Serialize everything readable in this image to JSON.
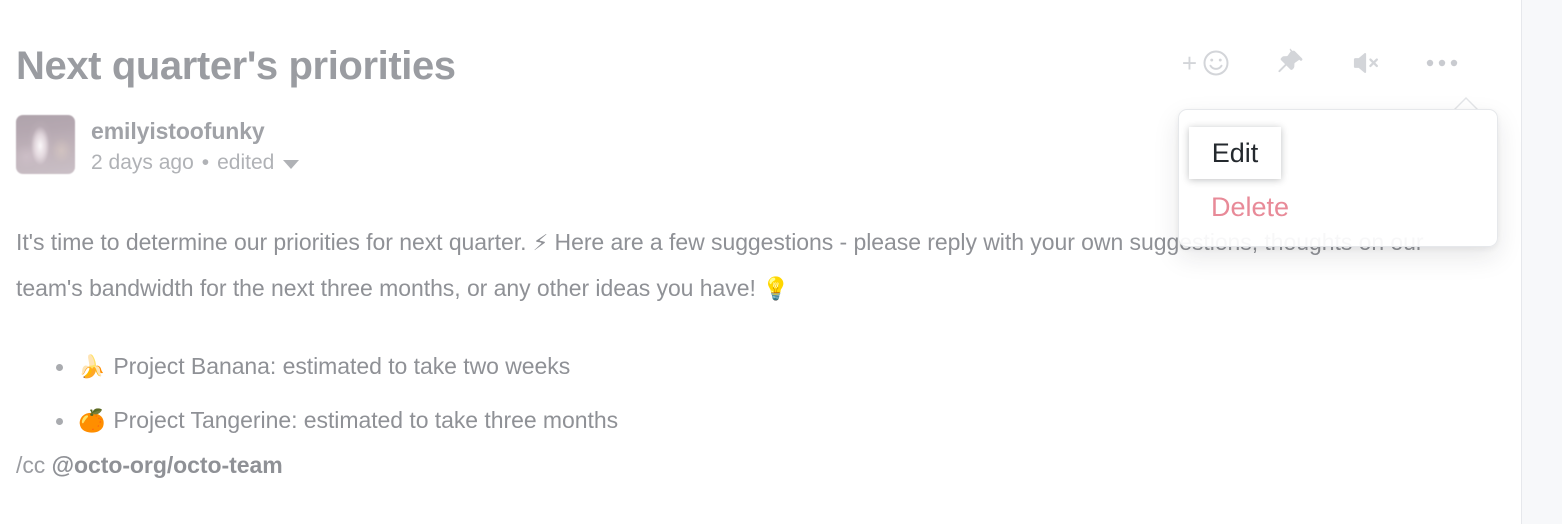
{
  "page": {
    "title": "Next quarter's priorities"
  },
  "header": {
    "actions": [
      {
        "name": "add-reaction-button",
        "icon": "plus-smiley-icon",
        "label": "+"
      },
      {
        "name": "pin-button",
        "icon": "pin-icon"
      },
      {
        "name": "mute-button",
        "icon": "mute-icon"
      },
      {
        "name": "more-options-button",
        "icon": "kebab-menu-icon"
      }
    ]
  },
  "author": {
    "avatar_alt": "avatar",
    "username": "emilyistoofunky",
    "timestamp": "2 days ago",
    "separator": "•",
    "edited_label": "edited"
  },
  "body": {
    "paragraph_part1": "It's time to determine our priorities for next quarter. ",
    "emoji_zap": "⚡",
    "paragraph_part2": " Here are a few suggestions - please reply with your own suggestions, thoughts on our team's bandwidth for the next three months, or any other ideas you have! ",
    "emoji_bulb": "💡",
    "bullets": [
      {
        "emoji": "🍌",
        "text": "Project Banana: estimated to take two weeks"
      },
      {
        "emoji": "🍊",
        "text": "Project Tangerine: estimated to take three months"
      }
    ],
    "cc_prefix": "/cc ",
    "cc_mention": "@octo-org/octo-team"
  },
  "menu": {
    "items": [
      {
        "label": "Edit",
        "state": "focused"
      },
      {
        "label": "Delete",
        "state": "danger"
      }
    ]
  },
  "colors": {
    "title": "#9a9ca1",
    "body_text": "#8f9196",
    "delete": "#e88a98",
    "edit": "#24292e",
    "icon": "#d3d5d9",
    "rail_bg": "#f7f8fa"
  }
}
